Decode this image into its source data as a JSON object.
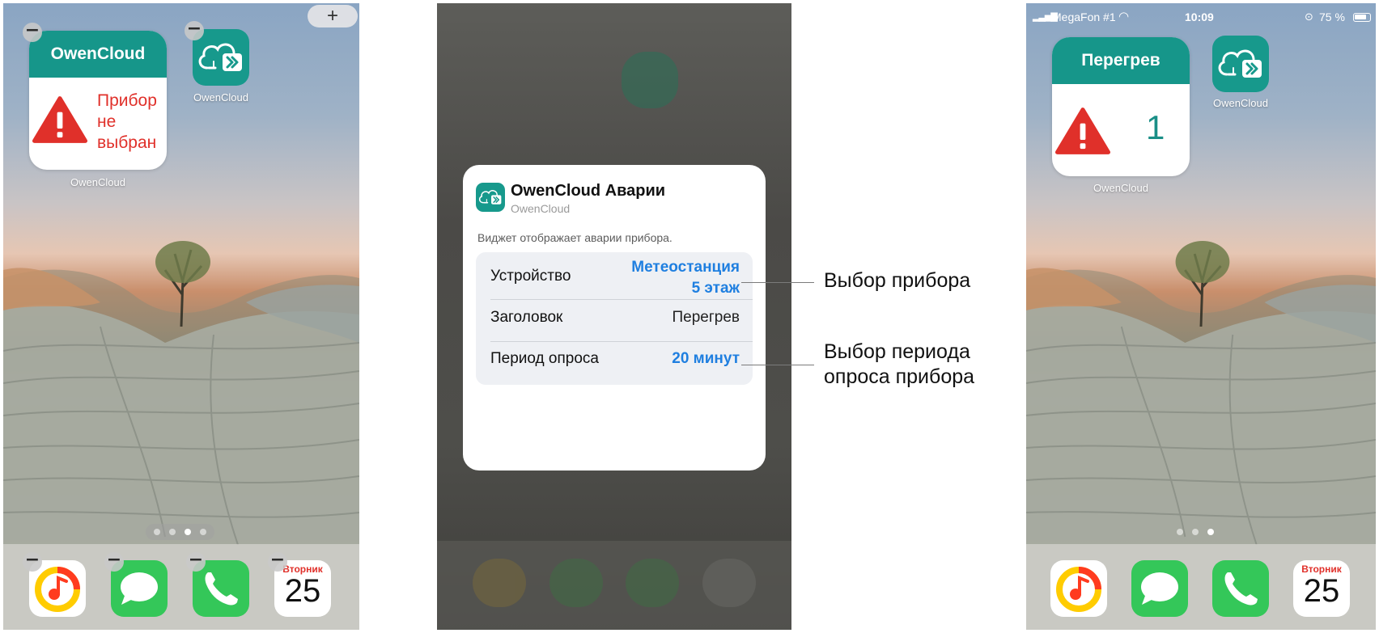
{
  "screen_left": {
    "widget": {
      "title": "OwenCloud",
      "message_lines": [
        "Прибор",
        "не",
        "выбран"
      ],
      "label": "OwenCloud"
    },
    "app_icon": {
      "label": "OwenCloud",
      "icon": "owencloud-app-icon"
    },
    "add_button": "+",
    "remove_badge": "−",
    "page_dots": 4,
    "active_page": 3,
    "dock": {
      "apps": [
        "yandex-music-icon",
        "messages-icon",
        "phone-icon",
        "calendar-icon"
      ],
      "calendar_day": "Вторник",
      "calendar_date": "25"
    }
  },
  "screen_middle": {
    "dialog": {
      "title": "OwenCloud Аварии",
      "subtitle": "OwenCloud",
      "description": "Виджет отображает аварии прибора.",
      "rows": [
        {
          "label": "Устройство",
          "value_lines": [
            "Метеостанция",
            "5 этаж"
          ]
        },
        {
          "label": "Заголовок",
          "value": "Перегрев"
        },
        {
          "label": "Период опроса",
          "value": "20 минут"
        }
      ]
    }
  },
  "callouts": {
    "device": "Выбор прибора",
    "period_lines": [
      "Выбор периода",
      "опроса прибора"
    ]
  },
  "screen_right": {
    "status_bar": {
      "carrier": "MegaFon #1",
      "time": "10:09",
      "battery": "75 %"
    },
    "widget": {
      "title": "Перегрев",
      "count": "1",
      "label": "OwenCloud"
    },
    "app_icon": {
      "label": "OwenCloud",
      "icon": "owencloud-app-icon"
    },
    "page_dots": 3,
    "active_page": 3,
    "dock": {
      "apps": [
        "yandex-music-icon",
        "messages-icon",
        "phone-icon",
        "calendar-icon"
      ],
      "calendar_day": "Вторник",
      "calendar_date": "25"
    }
  },
  "colors": {
    "widget_header": "#16968a",
    "alert_red": "#e0302a",
    "link_blue": "#1f7fe0",
    "count_teal": "#1a8f87"
  }
}
